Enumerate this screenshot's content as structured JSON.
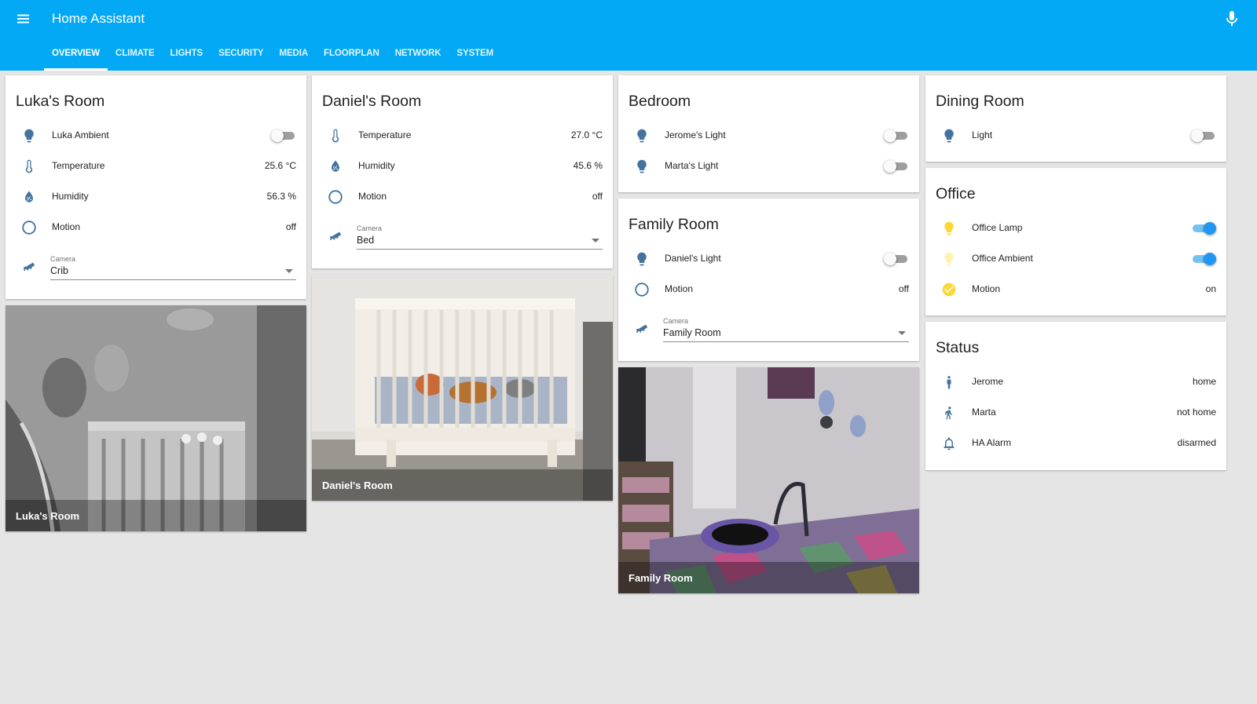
{
  "header": {
    "title": "Home Assistant",
    "menu_icon": "menu-icon",
    "mic_icon": "microphone-icon"
  },
  "tabs": [
    {
      "label": "OVERVIEW",
      "active": true
    },
    {
      "label": "CLIMATE"
    },
    {
      "label": "LIGHTS"
    },
    {
      "label": "SECURITY"
    },
    {
      "label": "MEDIA"
    },
    {
      "label": "FLOORPLAN"
    },
    {
      "label": "NETWORK"
    },
    {
      "label": "SYSTEM"
    }
  ],
  "colors": {
    "primary": "#03a9f4",
    "icon": "#44739e",
    "toggle_on": "#2196f3",
    "light_on": "#fdd835",
    "background": "#e5e5e5"
  },
  "cards": {
    "luka": {
      "title": "Luka's Room",
      "rows": [
        {
          "label": "Luka Ambient",
          "icon": "lightbulb-icon",
          "toggle": "off"
        },
        {
          "label": "Temperature",
          "icon": "thermometer-icon",
          "value": "25.6 °C"
        },
        {
          "label": "Humidity",
          "icon": "water-percent-icon",
          "value": "56.3 %"
        },
        {
          "label": "Motion",
          "icon": "motion-sensor-icon",
          "value": "off"
        }
      ],
      "camera_select": {
        "label": "Camera",
        "value": "Crib"
      },
      "camera_caption": "Luka's Room"
    },
    "daniel": {
      "title": "Daniel's Room",
      "rows": [
        {
          "label": "Temperature",
          "icon": "thermometer-icon",
          "value": "27.0 °C"
        },
        {
          "label": "Humidity",
          "icon": "water-percent-icon",
          "value": "45.6 %"
        },
        {
          "label": "Motion",
          "icon": "motion-sensor-icon",
          "value": "off"
        }
      ],
      "camera_select": {
        "label": "Camera",
        "value": "Bed"
      },
      "camera_caption": "Daniel's Room"
    },
    "bedroom": {
      "title": "Bedroom",
      "rows": [
        {
          "label": "Jerome's Light",
          "icon": "lightbulb-icon",
          "toggle": "off"
        },
        {
          "label": "Marta's Light",
          "icon": "lightbulb-icon",
          "toggle": "off"
        }
      ]
    },
    "family": {
      "title": "Family Room",
      "rows": [
        {
          "label": "Daniel's Light",
          "icon": "lightbulb-icon",
          "toggle": "off"
        },
        {
          "label": "Motion",
          "icon": "motion-sensor-icon",
          "value": "off"
        }
      ],
      "camera_select": {
        "label": "Camera",
        "value": "Family Room"
      },
      "camera_caption": "Family Room"
    },
    "dining": {
      "title": "Dining Room",
      "rows": [
        {
          "label": "Light",
          "icon": "lightbulb-icon",
          "toggle": "off"
        }
      ]
    },
    "office": {
      "title": "Office",
      "rows": [
        {
          "label": "Office Lamp",
          "icon": "lightbulb-icon",
          "toggle": "on"
        },
        {
          "label": "Office Ambient",
          "icon": "lightbulb-icon",
          "toggle": "on"
        },
        {
          "label": "Motion",
          "icon": "check-circle-icon",
          "value": "on"
        }
      ]
    },
    "status": {
      "title": "Status",
      "rows": [
        {
          "label": "Jerome",
          "icon": "person-icon",
          "value": "home"
        },
        {
          "label": "Marta",
          "icon": "person-walking-icon",
          "value": "not home"
        },
        {
          "label": "HA Alarm",
          "icon": "bell-icon",
          "value": "disarmed"
        }
      ]
    }
  }
}
